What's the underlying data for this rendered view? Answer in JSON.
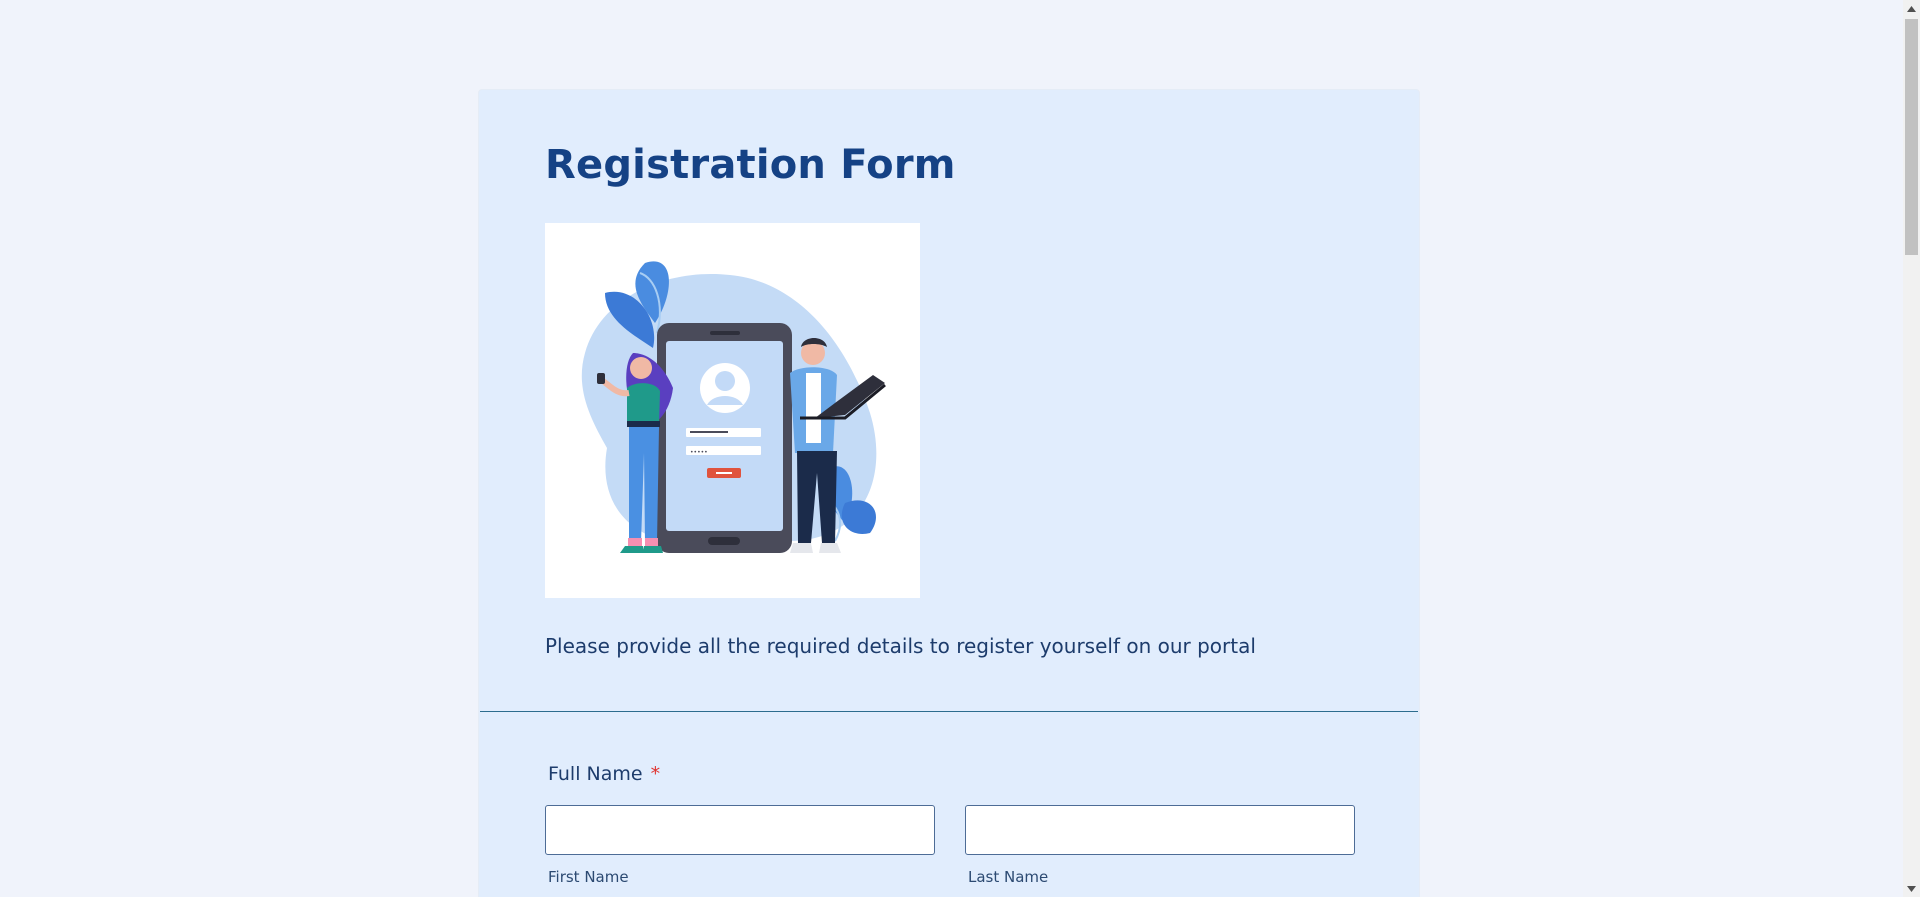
{
  "form": {
    "title": "Registration Form",
    "description": "Please provide all the required details to register yourself on our portal",
    "illustration_icon": "registration-illustration",
    "full_name": {
      "label": "Full Name",
      "required_marker": "*",
      "first_name": {
        "value": "",
        "sublabel": "First Name"
      },
      "last_name": {
        "value": "",
        "sublabel": "Last Name"
      }
    }
  },
  "colors": {
    "page_background": "#f0f3fb",
    "card_background": "#e1edfd",
    "title": "#154285",
    "required": "#e0312d",
    "divider": "#2c6c8e"
  },
  "scrollbar": {
    "up_icon": "scroll-up-arrow-icon",
    "down_icon": "scroll-down-arrow-icon"
  }
}
